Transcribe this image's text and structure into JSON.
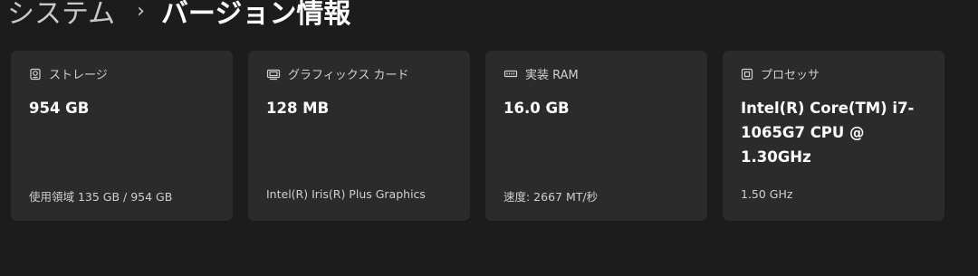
{
  "breadcrumb": {
    "parent": "システム",
    "separator": "›",
    "current": "バージョン情報"
  },
  "cards": [
    {
      "icon": "storage-icon",
      "title": "ストレージ",
      "value": "954 GB",
      "sub": "使用領域 135 GB / 954 GB"
    },
    {
      "icon": "graphics-card-icon",
      "title": "グラフィックス カード",
      "value": "128 MB",
      "sub": "Intel(R) Iris(R) Plus Graphics"
    },
    {
      "icon": "ram-icon",
      "title": "実装 RAM",
      "value": "16.0 GB",
      "sub": "速度: 2667 MT/秒"
    },
    {
      "icon": "processor-icon",
      "title": "プロセッサ",
      "value": "Intel(R) Core(TM) i7-1065G7 CPU @ 1.30GHz",
      "sub": "1.50 GHz"
    }
  ],
  "colors": {
    "background": "#1c1c1c",
    "card": "#2b2b2b",
    "text": "#ffffff",
    "subtext": "#cfcfcf"
  }
}
